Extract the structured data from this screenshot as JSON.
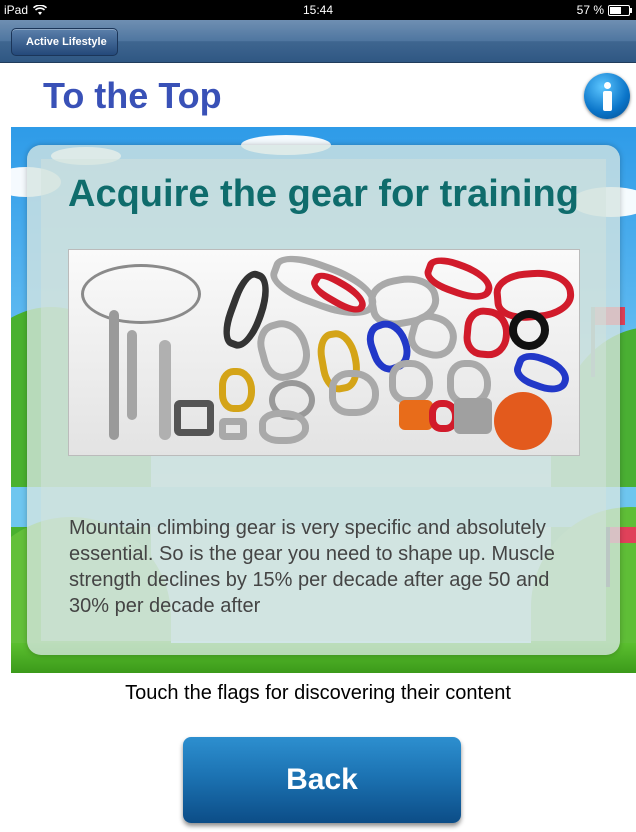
{
  "status_bar": {
    "device": "iPad",
    "time": "15:44",
    "battery": "57 %",
    "battery_level": 0.57
  },
  "nav": {
    "back_label": "Active Lifestyle"
  },
  "header": {
    "title": "To the Top"
  },
  "card": {
    "title": "Acquire the gear for training",
    "body": "Mountain climbing gear is very specific and absolutely essential. So is the gear you need to shape up. Muscle strength declines by 15% per decade after age 50 and 30% per decade after"
  },
  "hint": "Touch the flags for discovering their content",
  "back_button": "Back",
  "colors": {
    "title": "#3951b7",
    "card_title": "#0f6c6c",
    "button": "#1c73b3"
  }
}
